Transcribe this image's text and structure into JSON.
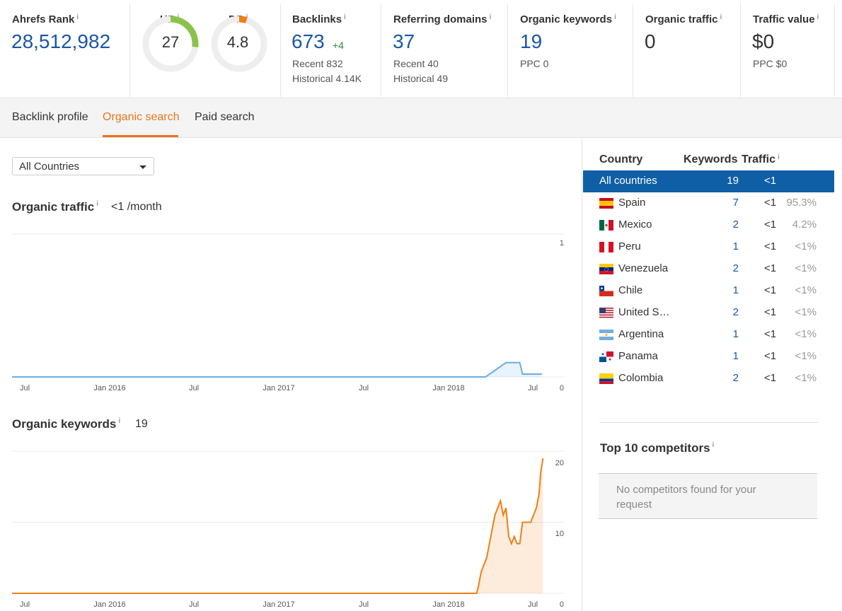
{
  "metrics": {
    "ahrefs_rank": {
      "label": "Ahrefs Rank",
      "value": "28,512,982"
    },
    "ur": {
      "label": "UR",
      "value": "27",
      "score": 27
    },
    "dr": {
      "label": "DR",
      "value": "4.8",
      "score": 4.8
    },
    "backlinks": {
      "label": "Backlinks",
      "value": "673",
      "delta": "+4",
      "recent": "Recent 832",
      "historical": "Historical 4.14K"
    },
    "referring_domains": {
      "label": "Referring domains",
      "value": "37",
      "recent": "Recent 40",
      "historical": "Historical 49"
    },
    "organic_keywords": {
      "label": "Organic keywords",
      "value": "19",
      "ppc": "PPC 0"
    },
    "organic_traffic": {
      "label": "Organic traffic",
      "value": "0"
    },
    "traffic_value": {
      "label": "Traffic value",
      "value": "$0",
      "ppc": "PPC $0"
    }
  },
  "info_mark": "i",
  "tabs": [
    {
      "label": "Backlink profile",
      "active": false
    },
    {
      "label": "Organic search",
      "active": true
    },
    {
      "label": "Paid search",
      "active": false
    }
  ],
  "country_filter": {
    "selected": "All Countries"
  },
  "traffic_section": {
    "title": "Organic traffic",
    "value": "<1 /month"
  },
  "keywords_section": {
    "title": "Organic keywords",
    "value": "19"
  },
  "chart_data": [
    {
      "type": "area",
      "title": "Organic traffic",
      "x_ticks": [
        "Jul",
        "Jan 2016",
        "Jul",
        "Jan 2017",
        "Jul",
        "Jan 2018",
        "Jul"
      ],
      "y_ticks": [
        "1",
        "0"
      ],
      "ylim": [
        0,
        1
      ],
      "series": [
        {
          "values": [
            [
              0,
              0
            ],
            [
              0.858,
              0
            ],
            [
              0.895,
              0.1
            ],
            [
              0.92,
              0.1
            ],
            [
              0.925,
              0.02
            ],
            [
              0.96,
              0.02
            ]
          ]
        }
      ],
      "color": "#6aaee6"
    },
    {
      "type": "area",
      "title": "Organic keywords",
      "x_ticks": [
        "Jul",
        "Jan 2016",
        "Jul",
        "Jan 2017",
        "Jul",
        "Jan 2018",
        "Jul"
      ],
      "y_ticks": [
        "20",
        "10",
        "0"
      ],
      "ylim": [
        0,
        20
      ],
      "series": [
        {
          "values": [
            [
              0,
              0
            ],
            [
              0.842,
              0
            ],
            [
              0.845,
              1
            ],
            [
              0.85,
              3
            ],
            [
              0.855,
              4
            ],
            [
              0.86,
              5
            ],
            [
              0.865,
              7
            ],
            [
              0.87,
              9
            ],
            [
              0.875,
              11
            ],
            [
              0.88,
              12
            ],
            [
              0.885,
              13
            ],
            [
              0.89,
              11
            ],
            [
              0.895,
              12
            ],
            [
              0.9,
              8
            ],
            [
              0.905,
              7
            ],
            [
              0.91,
              8
            ],
            [
              0.915,
              7
            ],
            [
              0.92,
              7
            ],
            [
              0.925,
              10
            ],
            [
              0.93,
              10
            ],
            [
              0.935,
              10
            ],
            [
              0.94,
              10
            ],
            [
              0.945,
              11
            ],
            [
              0.95,
              12
            ],
            [
              0.955,
              14
            ],
            [
              0.958,
              17
            ],
            [
              0.962,
              19
            ]
          ]
        }
      ],
      "color": "#f07e15"
    }
  ],
  "countries_table": {
    "headers": {
      "country": "Country",
      "keywords": "Keywords",
      "traffic": "Traffic"
    },
    "rows": [
      {
        "name": "All countries",
        "keywords": "19",
        "traffic": "<1",
        "share": "",
        "flag": "none",
        "selected": true
      },
      {
        "name": "Spain",
        "keywords": "7",
        "traffic": "<1",
        "share": "95.3%",
        "flag": "es"
      },
      {
        "name": "Mexico",
        "keywords": "2",
        "traffic": "<1",
        "share": "4.2%",
        "flag": "mx"
      },
      {
        "name": "Peru",
        "keywords": "1",
        "traffic": "<1",
        "share": "<1%",
        "flag": "pe"
      },
      {
        "name": "Venezuela",
        "keywords": "2",
        "traffic": "<1",
        "share": "<1%",
        "flag": "ve"
      },
      {
        "name": "Chile",
        "keywords": "1",
        "traffic": "<1",
        "share": "<1%",
        "flag": "cl"
      },
      {
        "name": "United S…",
        "keywords": "2",
        "traffic": "<1",
        "share": "<1%",
        "flag": "us"
      },
      {
        "name": "Argentina",
        "keywords": "1",
        "traffic": "<1",
        "share": "<1%",
        "flag": "ar"
      },
      {
        "name": "Panama",
        "keywords": "1",
        "traffic": "<1",
        "share": "<1%",
        "flag": "pa"
      },
      {
        "name": "Colombia",
        "keywords": "2",
        "traffic": "<1",
        "share": "<1%",
        "flag": "co"
      }
    ]
  },
  "competitors": {
    "title": "Top 10 competitors",
    "empty_message": "No competitors found for your request"
  },
  "colors": {
    "accent": "#e8741c",
    "link": "#1a56a5",
    "selected_row": "#0f5fa6",
    "ur_gauge": "#8bc34a",
    "dr_gauge": "#f07e15"
  }
}
